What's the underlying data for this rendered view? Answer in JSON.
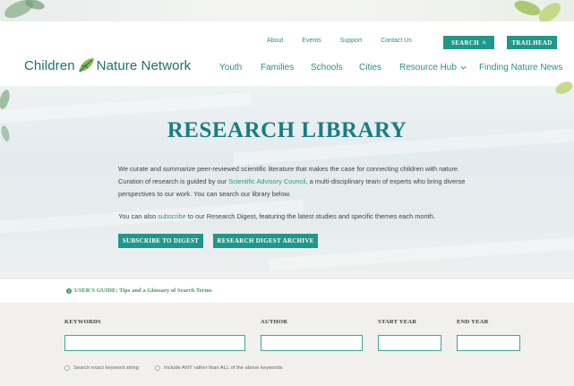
{
  "logo": {
    "part1": "Children",
    "part2": "Nature Network"
  },
  "util_nav": {
    "about": "About",
    "events": "Events",
    "support": "Support",
    "contact": "Contact Us"
  },
  "buttons": {
    "search": "SEARCH",
    "trailhead": "TRAILHEAD"
  },
  "main_nav": {
    "youth": "Youth",
    "families": "Families",
    "schools": "Schools",
    "cities": "Cities",
    "resource_hub": "Resource Hub",
    "news": "Finding Nature News"
  },
  "hero": {
    "title": "RESEARCH LIBRARY",
    "p1_a": "We curate and summarize peer-reviewed scientific literature that makes the case for connecting children with nature. Curation of research is guided by our ",
    "p1_link": "Scientific Advisory Council",
    "p1_b": ", a multi-disciplinary team of experts who bring diverse perspectives to our work. You can search our library below.",
    "p2_a": "You can also ",
    "p2_link": "subscribe",
    "p2_b": " to our Research Digest, featuring the latest studies and specific themes each month.",
    "btn_subscribe": "SUBSCRIBE TO DIGEST",
    "btn_archive": "RESEARCH DIGEST ARCHIVE"
  },
  "guide": {
    "text": "USER'S GUIDE: Tips and a Glossary of Search Terms"
  },
  "form": {
    "keywords_label": "KEYWORDS",
    "author_label": "AUTHOR",
    "start_year_label": "START YEAR",
    "end_year_label": "END YEAR",
    "option_exact": "Search exact keyword string",
    "option_any": "Include ANY rather than ALL of the above keywords"
  }
}
